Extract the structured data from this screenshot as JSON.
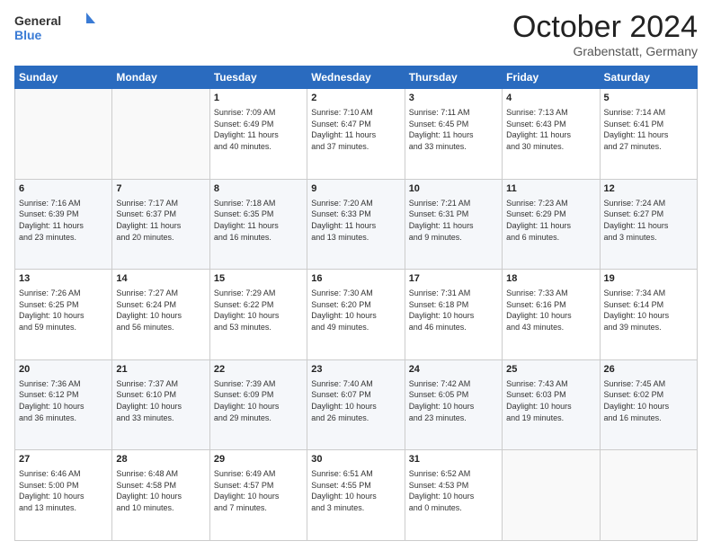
{
  "header": {
    "logo_general": "General",
    "logo_blue": "Blue",
    "month": "October 2024",
    "location": "Grabenstatt, Germany"
  },
  "weekdays": [
    "Sunday",
    "Monday",
    "Tuesday",
    "Wednesday",
    "Thursday",
    "Friday",
    "Saturday"
  ],
  "weeks": [
    [
      {
        "day": "",
        "info": ""
      },
      {
        "day": "",
        "info": ""
      },
      {
        "day": "1",
        "info": "Sunrise: 7:09 AM\nSunset: 6:49 PM\nDaylight: 11 hours\nand 40 minutes."
      },
      {
        "day": "2",
        "info": "Sunrise: 7:10 AM\nSunset: 6:47 PM\nDaylight: 11 hours\nand 37 minutes."
      },
      {
        "day": "3",
        "info": "Sunrise: 7:11 AM\nSunset: 6:45 PM\nDaylight: 11 hours\nand 33 minutes."
      },
      {
        "day": "4",
        "info": "Sunrise: 7:13 AM\nSunset: 6:43 PM\nDaylight: 11 hours\nand 30 minutes."
      },
      {
        "day": "5",
        "info": "Sunrise: 7:14 AM\nSunset: 6:41 PM\nDaylight: 11 hours\nand 27 minutes."
      }
    ],
    [
      {
        "day": "6",
        "info": "Sunrise: 7:16 AM\nSunset: 6:39 PM\nDaylight: 11 hours\nand 23 minutes."
      },
      {
        "day": "7",
        "info": "Sunrise: 7:17 AM\nSunset: 6:37 PM\nDaylight: 11 hours\nand 20 minutes."
      },
      {
        "day": "8",
        "info": "Sunrise: 7:18 AM\nSunset: 6:35 PM\nDaylight: 11 hours\nand 16 minutes."
      },
      {
        "day": "9",
        "info": "Sunrise: 7:20 AM\nSunset: 6:33 PM\nDaylight: 11 hours\nand 13 minutes."
      },
      {
        "day": "10",
        "info": "Sunrise: 7:21 AM\nSunset: 6:31 PM\nDaylight: 11 hours\nand 9 minutes."
      },
      {
        "day": "11",
        "info": "Sunrise: 7:23 AM\nSunset: 6:29 PM\nDaylight: 11 hours\nand 6 minutes."
      },
      {
        "day": "12",
        "info": "Sunrise: 7:24 AM\nSunset: 6:27 PM\nDaylight: 11 hours\nand 3 minutes."
      }
    ],
    [
      {
        "day": "13",
        "info": "Sunrise: 7:26 AM\nSunset: 6:25 PM\nDaylight: 10 hours\nand 59 minutes."
      },
      {
        "day": "14",
        "info": "Sunrise: 7:27 AM\nSunset: 6:24 PM\nDaylight: 10 hours\nand 56 minutes."
      },
      {
        "day": "15",
        "info": "Sunrise: 7:29 AM\nSunset: 6:22 PM\nDaylight: 10 hours\nand 53 minutes."
      },
      {
        "day": "16",
        "info": "Sunrise: 7:30 AM\nSunset: 6:20 PM\nDaylight: 10 hours\nand 49 minutes."
      },
      {
        "day": "17",
        "info": "Sunrise: 7:31 AM\nSunset: 6:18 PM\nDaylight: 10 hours\nand 46 minutes."
      },
      {
        "day": "18",
        "info": "Sunrise: 7:33 AM\nSunset: 6:16 PM\nDaylight: 10 hours\nand 43 minutes."
      },
      {
        "day": "19",
        "info": "Sunrise: 7:34 AM\nSunset: 6:14 PM\nDaylight: 10 hours\nand 39 minutes."
      }
    ],
    [
      {
        "day": "20",
        "info": "Sunrise: 7:36 AM\nSunset: 6:12 PM\nDaylight: 10 hours\nand 36 minutes."
      },
      {
        "day": "21",
        "info": "Sunrise: 7:37 AM\nSunset: 6:10 PM\nDaylight: 10 hours\nand 33 minutes."
      },
      {
        "day": "22",
        "info": "Sunrise: 7:39 AM\nSunset: 6:09 PM\nDaylight: 10 hours\nand 29 minutes."
      },
      {
        "day": "23",
        "info": "Sunrise: 7:40 AM\nSunset: 6:07 PM\nDaylight: 10 hours\nand 26 minutes."
      },
      {
        "day": "24",
        "info": "Sunrise: 7:42 AM\nSunset: 6:05 PM\nDaylight: 10 hours\nand 23 minutes."
      },
      {
        "day": "25",
        "info": "Sunrise: 7:43 AM\nSunset: 6:03 PM\nDaylight: 10 hours\nand 19 minutes."
      },
      {
        "day": "26",
        "info": "Sunrise: 7:45 AM\nSunset: 6:02 PM\nDaylight: 10 hours\nand 16 minutes."
      }
    ],
    [
      {
        "day": "27",
        "info": "Sunrise: 6:46 AM\nSunset: 5:00 PM\nDaylight: 10 hours\nand 13 minutes."
      },
      {
        "day": "28",
        "info": "Sunrise: 6:48 AM\nSunset: 4:58 PM\nDaylight: 10 hours\nand 10 minutes."
      },
      {
        "day": "29",
        "info": "Sunrise: 6:49 AM\nSunset: 4:57 PM\nDaylight: 10 hours\nand 7 minutes."
      },
      {
        "day": "30",
        "info": "Sunrise: 6:51 AM\nSunset: 4:55 PM\nDaylight: 10 hours\nand 3 minutes."
      },
      {
        "day": "31",
        "info": "Sunrise: 6:52 AM\nSunset: 4:53 PM\nDaylight: 10 hours\nand 0 minutes."
      },
      {
        "day": "",
        "info": ""
      },
      {
        "day": "",
        "info": ""
      }
    ]
  ]
}
